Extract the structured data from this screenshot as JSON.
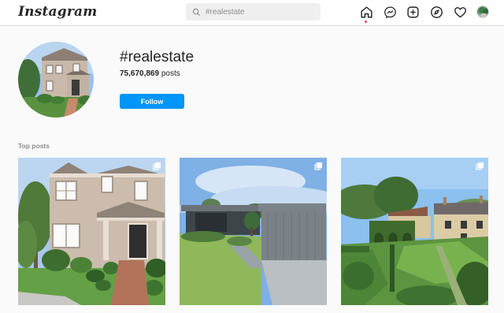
{
  "header": {
    "logo_text": "Instagram",
    "search_placeholder": "#realestate",
    "nav_icons": [
      "home-icon",
      "messenger-icon",
      "new-post-icon",
      "explore-icon",
      "activity-heart-icon",
      "profile-avatar"
    ]
  },
  "hashtag": {
    "title": "#realestate",
    "post_count": "75,670,869",
    "post_suffix": " posts",
    "follow_label": "Follow"
  },
  "sections": {
    "top_posts_label": "Top posts"
  },
  "posts": [
    {
      "type": "multiple",
      "icon": "multiple-posts-icon"
    },
    {
      "type": "multiple",
      "icon": "multiple-posts-icon"
    },
    {
      "type": "multiple",
      "icon": "multiple-posts-icon"
    }
  ],
  "colors": {
    "accent": "#0095f6",
    "notification_dot": "#ed4956",
    "text": "#262626",
    "muted": "#8e8e8e"
  }
}
